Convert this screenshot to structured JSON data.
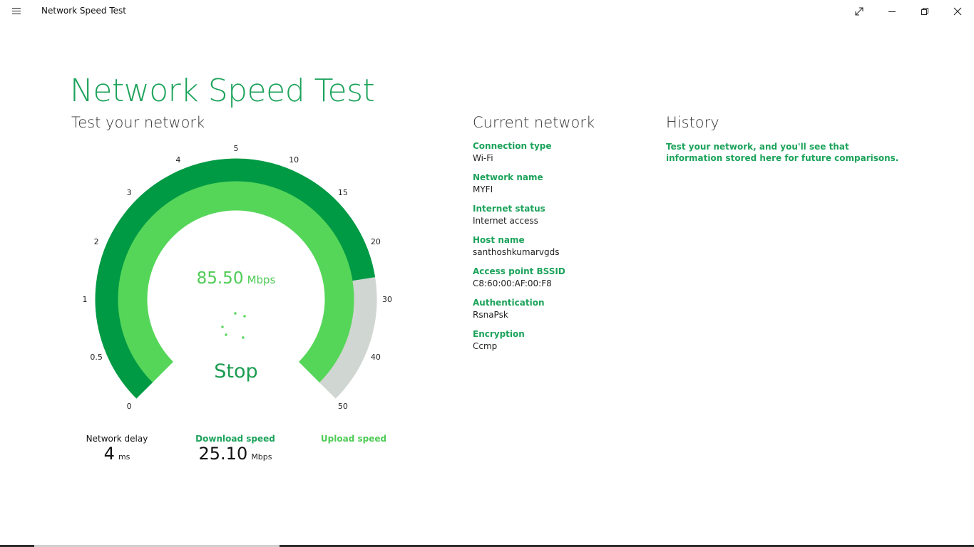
{
  "window": {
    "title": "Network Speed Test",
    "buttons": [
      "expand-icon",
      "minimize-icon",
      "restore-icon",
      "close-icon"
    ]
  },
  "header": {
    "title": "Network Speed Test",
    "test_subtitle": "Test your network"
  },
  "gauge": {
    "scale_labels": [
      "0",
      "0.5",
      "1",
      "2",
      "3",
      "4",
      "5",
      "10",
      "15",
      "20",
      "30",
      "40",
      "50"
    ],
    "current_speed": "85.50",
    "current_unit": "Mbps",
    "progress_fraction": 0.8,
    "action_label": "Stop",
    "colors": {
      "outer": "#009a44",
      "inner": "#55d659",
      "remaining": "#d0d6d1"
    }
  },
  "metrics": {
    "network_delay": {
      "label": "Network delay",
      "value": "4",
      "unit": "ms"
    },
    "download_speed": {
      "label": "Download speed",
      "value": "25.10",
      "unit": "Mbps"
    },
    "upload_speed": {
      "label": "Upload speed"
    }
  },
  "current_network": {
    "heading": "Current network",
    "items": [
      {
        "key": "Connection type",
        "value": "Wi-Fi"
      },
      {
        "key": "Network name",
        "value": "MYFI"
      },
      {
        "key": "Internet status",
        "value": "Internet access"
      },
      {
        "key": "Host name",
        "value": "santhoshkumarvgds"
      },
      {
        "key": "Access point BSSID",
        "value": "C8:60:00:AF:00:F8"
      },
      {
        "key": "Authentication",
        "value": "RsnaPsk"
      },
      {
        "key": "Encryption",
        "value": "Ccmp"
      }
    ]
  },
  "history": {
    "heading": "History",
    "message": "Test your network, and you'll see that information stored here for future comparisons."
  },
  "accent_color": "#1ca35b"
}
